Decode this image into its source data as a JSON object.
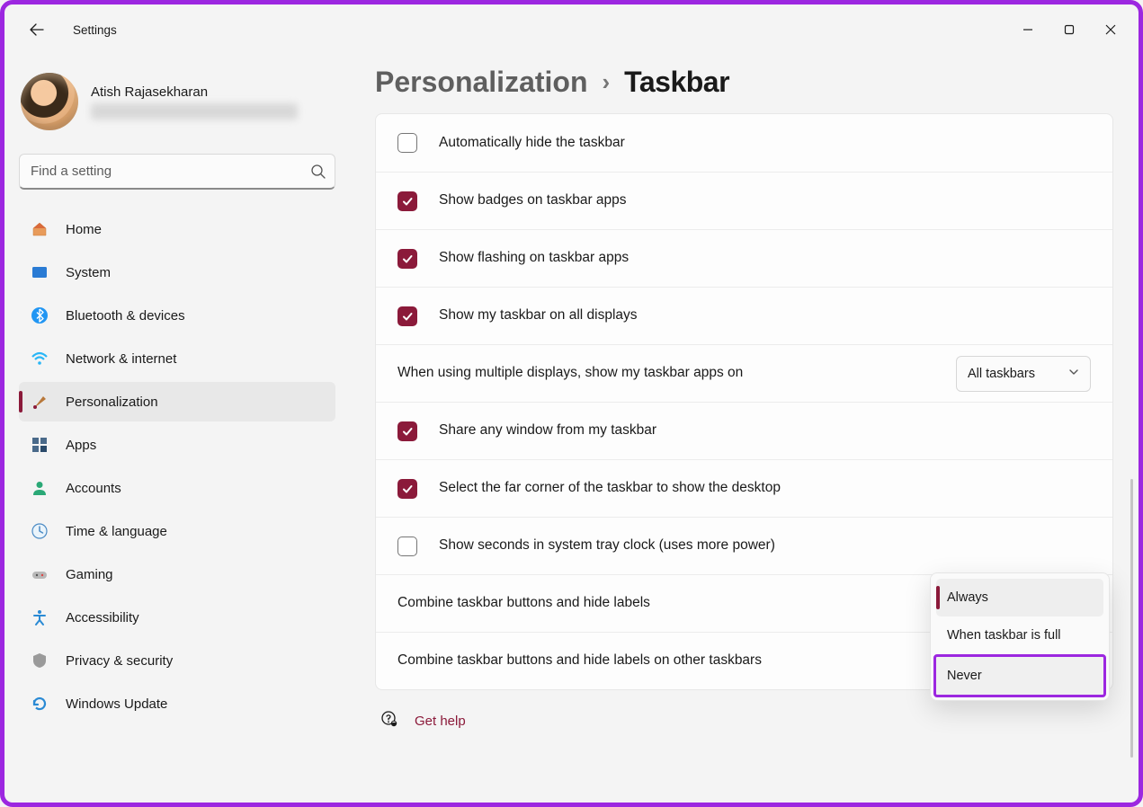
{
  "app": {
    "title": "Settings"
  },
  "user": {
    "name": "Atish Rajasekharan"
  },
  "search": {
    "placeholder": "Find a setting"
  },
  "nav": [
    {
      "key": "home",
      "label": "Home"
    },
    {
      "key": "system",
      "label": "System"
    },
    {
      "key": "bluetooth",
      "label": "Bluetooth & devices"
    },
    {
      "key": "network",
      "label": "Network & internet"
    },
    {
      "key": "personalization",
      "label": "Personalization",
      "active": true
    },
    {
      "key": "apps",
      "label": "Apps"
    },
    {
      "key": "accounts",
      "label": "Accounts"
    },
    {
      "key": "time",
      "label": "Time & language"
    },
    {
      "key": "gaming",
      "label": "Gaming"
    },
    {
      "key": "accessibility",
      "label": "Accessibility"
    },
    {
      "key": "privacy",
      "label": "Privacy & security"
    },
    {
      "key": "update",
      "label": "Windows Update"
    }
  ],
  "breadcrumb": {
    "parent": "Personalization",
    "current": "Taskbar"
  },
  "settings": {
    "autohide": {
      "label": "Automatically hide the taskbar",
      "checked": false
    },
    "badges": {
      "label": "Show badges on taskbar apps",
      "checked": true
    },
    "flashing": {
      "label": "Show flashing on taskbar apps",
      "checked": true
    },
    "alldisplays": {
      "label": "Show my taskbar on all displays",
      "checked": true
    },
    "multi": {
      "label": "When using multiple displays, show my taskbar apps on",
      "value": "All taskbars"
    },
    "share": {
      "label": "Share any window from my taskbar",
      "checked": true
    },
    "corner": {
      "label": "Select the far corner of the taskbar to show the desktop",
      "checked": true
    },
    "seconds": {
      "label": "Show seconds in system tray clock (uses more power)",
      "checked": false
    },
    "combine1": {
      "label": "Combine taskbar buttons and hide labels"
    },
    "combine2": {
      "label": "Combine taskbar buttons and hide labels on other taskbars"
    }
  },
  "dropdown_menu": {
    "opt1": "Always",
    "opt2": "When taskbar is full",
    "opt3": "Never"
  },
  "help": {
    "label": "Get help"
  }
}
